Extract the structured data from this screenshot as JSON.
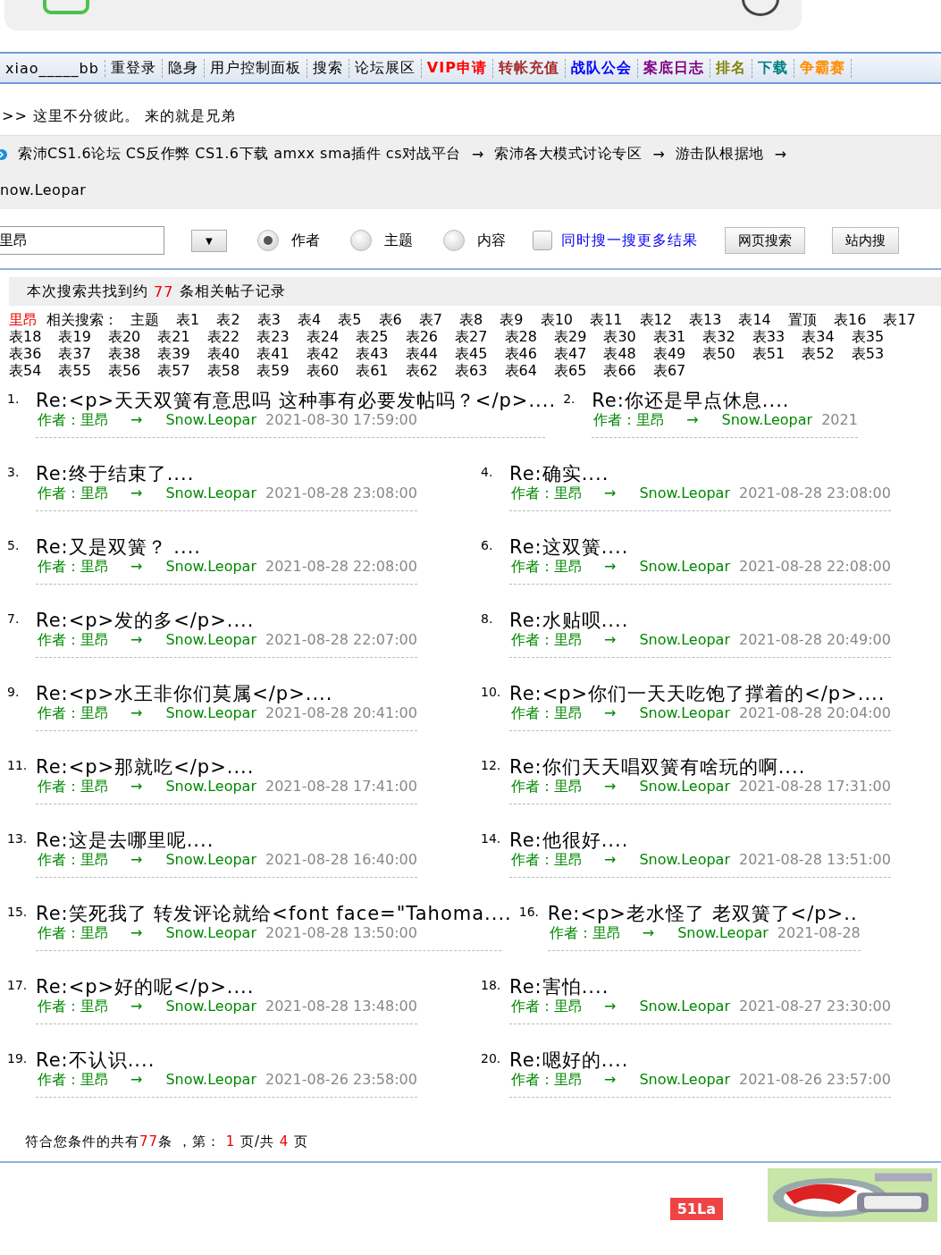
{
  "nav": [
    {
      "label": "xiao_____bb",
      "color": "#000000"
    },
    {
      "label": "重登录",
      "color": "#000000"
    },
    {
      "label": "隐身",
      "color": "#000000"
    },
    {
      "label": "用户控制面板",
      "color": "#000000"
    },
    {
      "label": "搜索",
      "color": "#000000"
    },
    {
      "label": "论坛展区",
      "color": "#000000"
    },
    {
      "label": "VIP申请",
      "color": "#ff0000"
    },
    {
      "label": "转帐充值",
      "color": "#a52a2a"
    },
    {
      "label": "战队公会",
      "color": "#0000ff"
    },
    {
      "label": "案底日志",
      "color": "#800080"
    },
    {
      "label": "排名",
      "color": "#808000"
    },
    {
      "label": "下载",
      "color": "#008080"
    },
    {
      "label": "争霸赛",
      "color": "#ff8c00"
    }
  ],
  "welcome": ">> 这里不分彼此。 来的就是兄弟",
  "breadcrumb": [
    {
      "label": "索沛CS1.6论坛 CS反作弊 CS1.6下载 amxx sma插件 cs对战平台",
      "arrow": "→"
    },
    {
      "label": "索沛各大模式讨论专区",
      "arrow": "→"
    },
    {
      "label": "游击队根据地",
      "arrow": "→"
    },
    {
      "label": "now.Leopar"
    }
  ],
  "search": {
    "value": "里昂",
    "dropdown": "▼",
    "options": [
      {
        "label": "作者",
        "selected": true
      },
      {
        "label": "主题",
        "selected": false
      },
      {
        "label": "内容",
        "selected": false
      }
    ],
    "more": {
      "label": "同时搜一搜更多结果",
      "checked": false
    },
    "buttons": [
      "网页搜索",
      "站内搜"
    ]
  },
  "summary": {
    "prefix": "本次搜索共找到约",
    "count": "77",
    "suffix": "条相关帖子记录"
  },
  "related": {
    "keyword": "里昂",
    "label": "相关搜索：",
    "tags": [
      "主题",
      "表1",
      "表2",
      "表3",
      "表4",
      "表5",
      "表6",
      "表7",
      "表8",
      "表9",
      "表10",
      "表11",
      "表12",
      "表13",
      "表14",
      "置顶",
      "表16",
      "表17",
      "表18",
      "表19",
      "表20",
      "表21",
      "表22",
      "表23",
      "表24",
      "表25",
      "表26",
      "表27",
      "表28",
      "表29",
      "表30",
      "表31",
      "表32",
      "表33",
      "表34",
      "表35",
      "表36",
      "表37",
      "表38",
      "表39",
      "表40",
      "表41",
      "表42",
      "表43",
      "表44",
      "表45",
      "表46",
      "表47",
      "表48",
      "表49",
      "表50",
      "表51",
      "表52",
      "表53",
      "表54",
      "表55",
      "表56",
      "表57",
      "表58",
      "表59",
      "表60",
      "表61",
      "表62",
      "表63",
      "表64",
      "表65",
      "表66",
      "表67"
    ]
  },
  "results": [
    {
      "number": "1.",
      "title": "Re:<p>天天双簧有意思吗 这种事有必要发帖吗？</p>....",
      "author_label": "作者：",
      "author": "里昂",
      "arrow": "→",
      "board": "Snow.Leopar",
      "date": "2021-08-30 17:59:00"
    },
    {
      "number": "2.",
      "title": "Re:你还是早点休息....",
      "author_label": "作者：",
      "author": "里昂",
      "arrow": "→",
      "board": "Snow.Leopar",
      "date": "2021"
    },
    {
      "number": "3.",
      "title": "Re:终于结束了....",
      "author_label": "作者：",
      "author": "里昂",
      "arrow": "→",
      "board": "Snow.Leopar",
      "date": "2021-08-28 23:08:00"
    },
    {
      "number": "4.",
      "title": "Re:确实....",
      "author_label": "作者：",
      "author": "里昂",
      "arrow": "→",
      "board": "Snow.Leopar",
      "date": "2021-08-28 23:08:00"
    },
    {
      "number": "5.",
      "title": "Re:又是双簧？ ....",
      "author_label": "作者：",
      "author": "里昂",
      "arrow": "→",
      "board": "Snow.Leopar",
      "date": "2021-08-28 22:08:00"
    },
    {
      "number": "6.",
      "title": "Re:这双簧....",
      "author_label": "作者：",
      "author": "里昂",
      "arrow": "→",
      "board": "Snow.Leopar",
      "date": "2021-08-28 22:08:00"
    },
    {
      "number": "7.",
      "title": "Re:<p>发的多</p>....",
      "author_label": "作者：",
      "author": "里昂",
      "arrow": "→",
      "board": "Snow.Leopar",
      "date": "2021-08-28 22:07:00"
    },
    {
      "number": "8.",
      "title": "Re:水贴呗....",
      "author_label": "作者：",
      "author": "里昂",
      "arrow": "→",
      "board": "Snow.Leopar",
      "date": "2021-08-28 20:49:00"
    },
    {
      "number": "9.",
      "title": "Re:<p>水王非你们莫属</p>....",
      "author_label": "作者：",
      "author": "里昂",
      "arrow": "→",
      "board": "Snow.Leopar",
      "date": "2021-08-28 20:41:00"
    },
    {
      "number": "10.",
      "title": "Re:<p>你们一天天吃饱了撑着的</p>....",
      "author_label": "作者：",
      "author": "里昂",
      "arrow": "→",
      "board": "Snow.Leopar",
      "date": "2021-08-28 20:04:00"
    },
    {
      "number": "11.",
      "title": "Re:<p>那就吃</p>....",
      "author_label": "作者：",
      "author": "里昂",
      "arrow": "→",
      "board": "Snow.Leopar",
      "date": "2021-08-28 17:41:00"
    },
    {
      "number": "12.",
      "title": "Re:你们天天唱双簧有啥玩的啊....",
      "author_label": "作者：",
      "author": "里昂",
      "arrow": "→",
      "board": "Snow.Leopar",
      "date": "2021-08-28 17:31:00"
    },
    {
      "number": "13.",
      "title": "Re:这是去哪里呢....",
      "author_label": "作者：",
      "author": "里昂",
      "arrow": "→",
      "board": "Snow.Leopar",
      "date": "2021-08-28 16:40:00"
    },
    {
      "number": "14.",
      "title": "Re:他很好....",
      "author_label": "作者：",
      "author": "里昂",
      "arrow": "→",
      "board": "Snow.Leopar",
      "date": "2021-08-28 13:51:00"
    },
    {
      "number": "15.",
      "title": "Re:笑死我了 转发评论就给<font face=\"Tahoma....",
      "author_label": "作者：",
      "author": "里昂",
      "arrow": "→",
      "board": "Snow.Leopar",
      "date": "2021-08-28 13:50:00"
    },
    {
      "number": "16.",
      "title": "Re:<p>老水怪了 老双簧了</p>..",
      "author_label": "作者：",
      "author": "里昂",
      "arrow": "→",
      "board": "Snow.Leopar",
      "date": "2021-08-28"
    },
    {
      "number": "17.",
      "title": "Re:<p>好的呢</p>....",
      "author_label": "作者：",
      "author": "里昂",
      "arrow": "→",
      "board": "Snow.Leopar",
      "date": "2021-08-28 13:48:00"
    },
    {
      "number": "18.",
      "title": "Re:害怕....",
      "author_label": "作者：",
      "author": "里昂",
      "arrow": "→",
      "board": "Snow.Leopar",
      "date": "2021-08-27 23:30:00"
    },
    {
      "number": "19.",
      "title": "Re:不认识....",
      "author_label": "作者：",
      "author": "里昂",
      "arrow": "→",
      "board": "Snow.Leopar",
      "date": "2021-08-26 23:58:00"
    },
    {
      "number": "20.",
      "title": "Re:嗯好的....",
      "author_label": "作者：",
      "author": "里昂",
      "arrow": "→",
      "board": "Snow.Leopar",
      "date": "2021-08-26 23:57:00"
    }
  ],
  "pager": {
    "before": "符合您条件的共有",
    "total": "77",
    "mid": "条 ，第：",
    "page": "1",
    "mid2": "页/共",
    "pages": "4",
    "after": "页"
  },
  "footer": {
    "badge": "51La"
  }
}
